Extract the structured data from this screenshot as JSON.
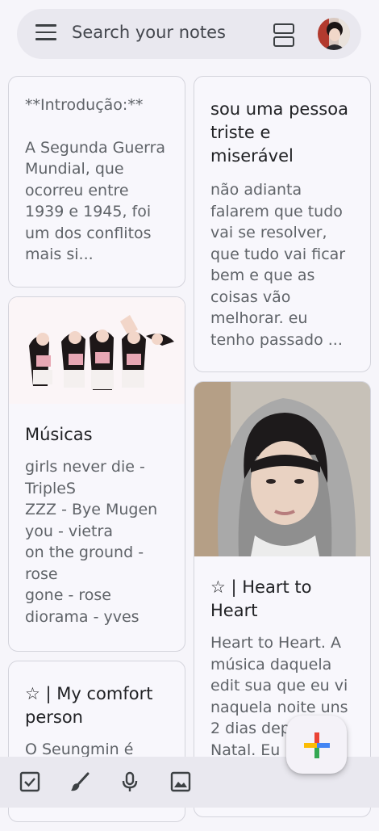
{
  "search": {
    "placeholder": "Search your notes"
  },
  "icons": {
    "menu": "menu-icon",
    "layout": "view-layout-icon",
    "checkbox": "checkbox-icon",
    "brush": "brush-icon",
    "mic": "mic-icon",
    "image": "image-icon",
    "fab": "plus-icon"
  },
  "notes_left": [
    {
      "heading": "**Introdução:**",
      "body": "A Segunda Guerra Mundial, que ocorreu entre 1939 e 1945, foi um dos conflitos mais si..."
    },
    {
      "title": "Músicas",
      "body": "girls never die - TripleS\nZZZ - Bye Mugen\nyou - vietra\non the ground - rose\ngone - rose\ndiorama - yves"
    },
    {
      "title": "☆ | My comfort person",
      "body": "O Seungmin é"
    }
  ],
  "notes_right": [
    {
      "title": "sou uma pessoa triste e miserável",
      "body": "não adianta falarem que tudo vai se resolver, que tudo vai ficar bem e que as coisas vão melhorar. eu tenho passado ..."
    },
    {
      "title": "☆ | Heart to Heart",
      "body": "Heart to Heart. A música daquela edit sua que eu vi naquela noite uns 2 dias dep... Natal. Eu ... ometer"
    }
  ],
  "colors": {
    "background": "#f6f5fa",
    "card_border": "#d4d4dc",
    "bar": "#e9e8ef",
    "google_blue": "#4285f4",
    "google_red": "#ea4335",
    "google_yellow": "#fbbc05",
    "google_green": "#34a853"
  }
}
